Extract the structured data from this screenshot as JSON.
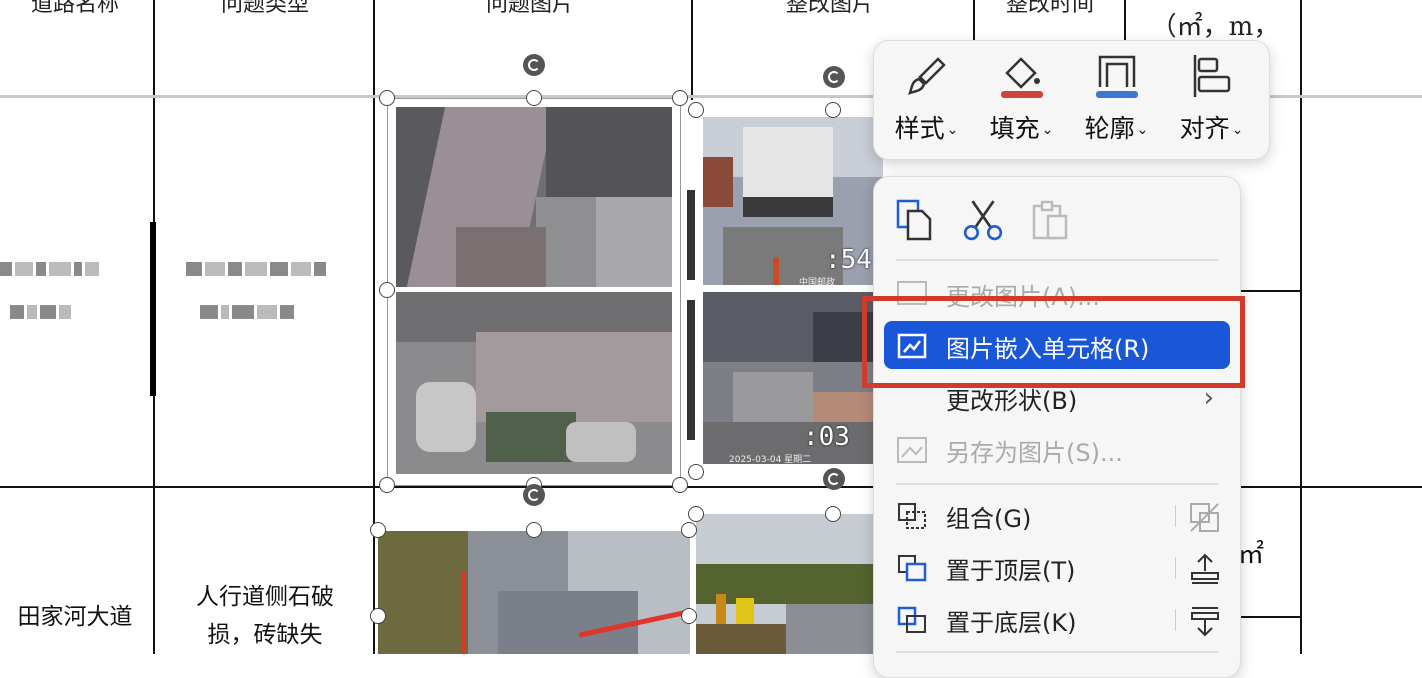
{
  "table": {
    "headers": [
      "道路名称",
      "问题类型",
      "问题图片",
      "整改图片",
      "整改时间",
      "（㎡，m，"
    ],
    "row2": {
      "road": "田家河大道",
      "issue_line1": "人行道侧石破",
      "issue_line2": "损，砖缺失",
      "partial_unit": "㎡"
    }
  },
  "photos": {
    "timestamp_1": ":54",
    "timestamp_2": ":03",
    "watermark_1": "中国邮政",
    "watermark_2": "2025-03-04 星期二"
  },
  "toolbar": {
    "items": [
      {
        "label": "样式",
        "icon": "brush-icon"
      },
      {
        "label": "填充",
        "icon": "fill-bucket-icon",
        "color": "#d0433a"
      },
      {
        "label": "轮廓",
        "icon": "outline-icon",
        "color": "#3b79d0"
      },
      {
        "label": "对齐",
        "icon": "align-left-icon"
      }
    ]
  },
  "menu": {
    "top_icons": [
      "copy-icon",
      "cut-icon",
      "paste-icon"
    ],
    "items": [
      {
        "label": "更改图片(A)...",
        "state": "disabled",
        "icon": "change-picture-icon"
      },
      {
        "label": "图片嵌入单元格(R)",
        "state": "active",
        "icon": "embed-in-cell-icon"
      },
      {
        "label": "更改形状(B)",
        "state": "normal",
        "icon": "",
        "submenu": true
      },
      {
        "label": "另存为图片(S)...",
        "state": "disabled",
        "icon": "save-as-picture-icon"
      },
      {
        "label": "组合(G)",
        "state": "normal",
        "icon": "group-icon",
        "shortcut_icon": "ungroup-icon"
      },
      {
        "label": "置于顶层(T)",
        "state": "normal",
        "icon": "bring-to-front-icon",
        "shortcut_icon": "bring-forward-icon"
      },
      {
        "label": "置于底层(K)",
        "state": "normal",
        "icon": "send-to-back-icon",
        "shortcut_icon": "send-backward-icon"
      }
    ],
    "highlight_color": "#1957d8"
  }
}
